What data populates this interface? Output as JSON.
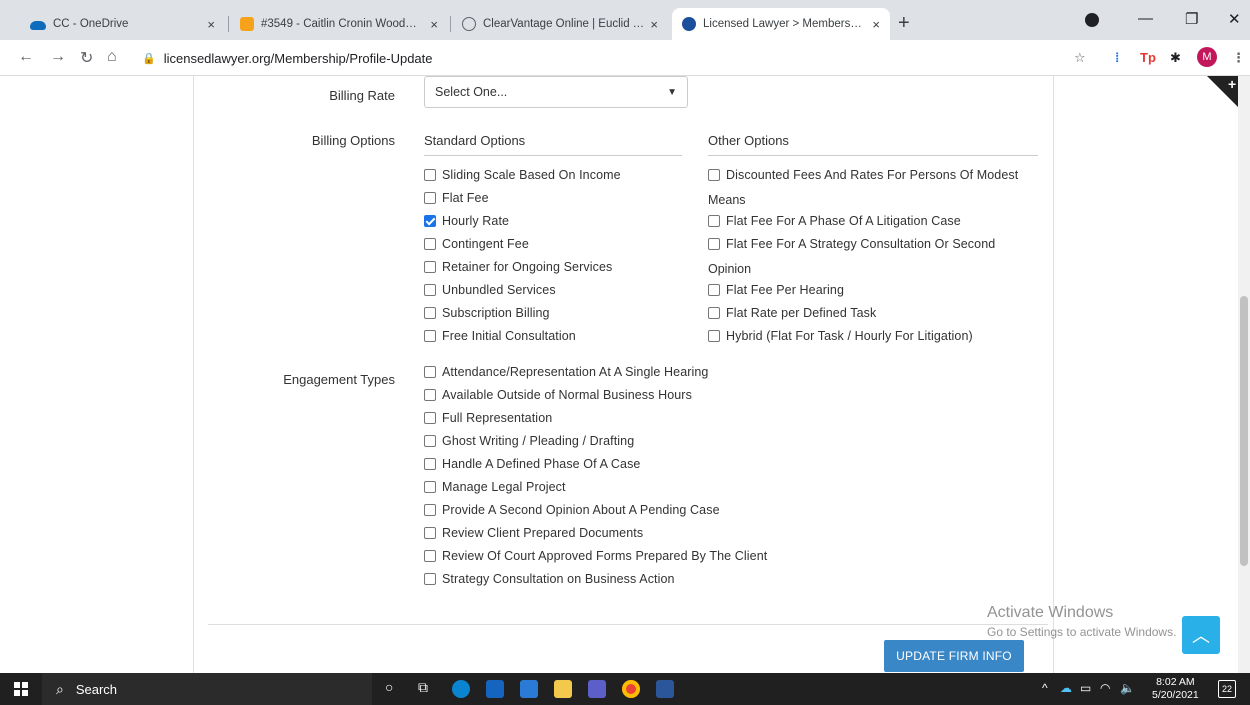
{
  "browser": {
    "tabs": [
      {
        "label": "CC - OneDrive",
        "icon": "onedrive-icon"
      },
      {
        "label": "#3549 - Caitlin Cronin Woodwar...",
        "icon": "orange-logo-icon"
      },
      {
        "label": "ClearVantage Online | Euclid Tech...",
        "icon": "globe-icon"
      },
      {
        "label": "Licensed Lawyer > Membership...",
        "icon": "shield-icon"
      }
    ],
    "url": "licensedlawyer.org/Membership/Profile-Update",
    "profile_initial": "M"
  },
  "form": {
    "billing_rate": {
      "label": "Billing Rate",
      "selected": "Select One..."
    },
    "billing_options": {
      "label": "Billing Options",
      "standard_header": "Standard Options",
      "other_header": "Other Options",
      "standard": [
        {
          "label": "Sliding Scale Based On Income",
          "checked": false
        },
        {
          "label": "Flat Fee",
          "checked": false
        },
        {
          "label": "Hourly Rate",
          "checked": true
        },
        {
          "label": "Contingent Fee",
          "checked": false
        },
        {
          "label": "Retainer for Ongoing Services",
          "checked": false
        },
        {
          "label": "Unbundled Services",
          "checked": false
        },
        {
          "label": "Subscription Billing",
          "checked": false
        },
        {
          "label": "Free Initial Consultation",
          "checked": false
        }
      ],
      "other": [
        {
          "label": "Discounted Fees And Rates For Persons Of Modest",
          "cont": "Means",
          "checked": false
        },
        {
          "label": "Flat Fee For A Phase Of A Litigation Case",
          "checked": false
        },
        {
          "label": "Flat Fee For A Strategy Consultation Or Second",
          "cont": "Opinion",
          "checked": false
        },
        {
          "label": "Flat Fee Per Hearing",
          "checked": false
        },
        {
          "label": "Flat Rate per Defined Task",
          "checked": false
        },
        {
          "label": "Hybrid (Flat For Task / Hourly For Litigation)",
          "checked": false
        }
      ]
    },
    "engagement_types": {
      "label": "Engagement Types",
      "items": [
        {
          "label": "Attendance/Representation At A Single Hearing",
          "checked": false
        },
        {
          "label": "Available Outside of Normal Business Hours",
          "checked": false
        },
        {
          "label": "Full Representation",
          "checked": false
        },
        {
          "label": "Ghost Writing / Pleading / Drafting",
          "checked": false
        },
        {
          "label": "Handle A Defined Phase Of A Case",
          "checked": false
        },
        {
          "label": "Manage Legal Project",
          "checked": false
        },
        {
          "label": "Provide A Second Opinion About A Pending Case",
          "checked": false
        },
        {
          "label": "Review Client Prepared Documents",
          "checked": false
        },
        {
          "label": "Review Of Court Approved Forms Prepared By The Client",
          "checked": false
        },
        {
          "label": "Strategy Consultation on Business Action",
          "checked": false
        }
      ]
    },
    "submit_label": "UPDATE FIRM INFO"
  },
  "watermark": {
    "line1": "Activate Windows",
    "line2": "Go to Settings to activate Windows."
  },
  "taskbar": {
    "search_label": "Search",
    "time": "8:02 AM",
    "date": "5/20/2021",
    "notifications": "22"
  }
}
